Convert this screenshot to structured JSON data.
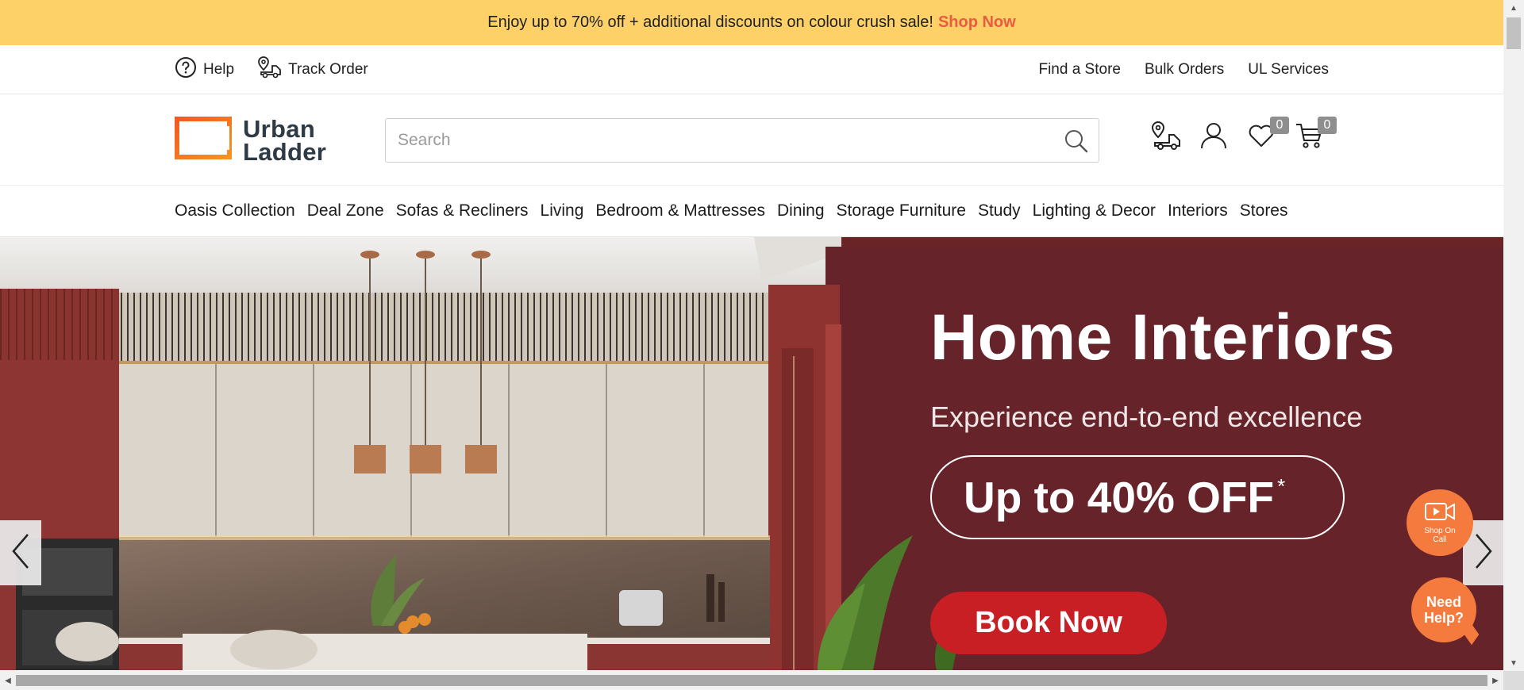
{
  "promo": {
    "text": "Enjoy up to 70% off + additional discounts on colour crush sale!",
    "link": "Shop Now"
  },
  "utility": {
    "help": "Help",
    "track_order": "Track Order",
    "find_store": "Find a Store",
    "bulk_orders": "Bulk Orders",
    "ul_services": "UL Services"
  },
  "header": {
    "logo_line1": "Urban",
    "logo_line2": "Ladder",
    "search_placeholder": "Search",
    "wishlist_count": "0",
    "cart_count": "0"
  },
  "nav": {
    "items": [
      "Oasis Collection",
      "Deal Zone",
      "Sofas & Recliners",
      "Living",
      "Bedroom & Mattresses",
      "Dining",
      "Storage Furniture",
      "Study",
      "Lighting & Decor",
      "Interiors",
      "Stores"
    ]
  },
  "hero": {
    "title": "Home Interiors",
    "subtitle": "Experience end-to-end excellence",
    "offer": "Up to 40% OFF",
    "offer_mark": "*",
    "cta": "Book Now"
  },
  "floating": {
    "shop_on_call": "Shop On Call",
    "need_help": "Need Help?"
  },
  "colors": {
    "promo_bg": "#fdd068",
    "shop_now": "#e85c41",
    "hero_bg": "#6b2426",
    "cta_red": "#c71f24",
    "floating_orange": "#f47a3e"
  }
}
